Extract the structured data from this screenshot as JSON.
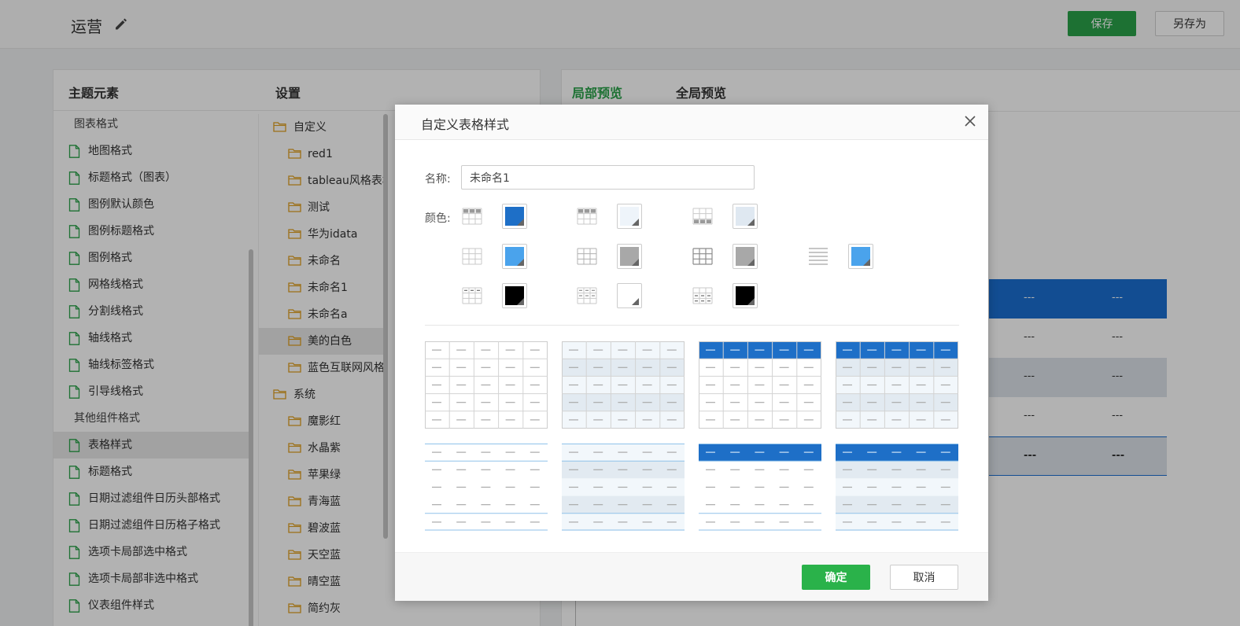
{
  "header": {
    "title": "运营",
    "save_label": "保存",
    "save_as_label": "另存为"
  },
  "left_panel": {
    "theme_title": "主题元素",
    "settings_title": "设置",
    "theme_items": [
      {
        "label": "图表格式",
        "group": true
      },
      {
        "label": "地图格式"
      },
      {
        "label": "标题格式（图表）"
      },
      {
        "label": "图例默认颜色"
      },
      {
        "label": "图例标题格式"
      },
      {
        "label": "图例格式"
      },
      {
        "label": "网格线格式"
      },
      {
        "label": "分割线格式"
      },
      {
        "label": "轴线格式"
      },
      {
        "label": "轴线标签格式"
      },
      {
        "label": "引导线格式"
      },
      {
        "label": "其他组件格式",
        "group": true
      },
      {
        "label": "表格样式",
        "selected": true
      },
      {
        "label": "标题格式"
      },
      {
        "label": "日期过滤组件日历头部格式"
      },
      {
        "label": "日期过滤组件日历格子格式"
      },
      {
        "label": "选项卡局部选中格式"
      },
      {
        "label": "选项卡局部非选中格式"
      },
      {
        "label": "仪表组件样式"
      }
    ],
    "settings_items": [
      {
        "label": "自定义",
        "top": true
      },
      {
        "label": "red1"
      },
      {
        "label": "tableau风格表格"
      },
      {
        "label": "测试"
      },
      {
        "label": "华为idata"
      },
      {
        "label": "未命名"
      },
      {
        "label": "未命名1"
      },
      {
        "label": "未命名a"
      },
      {
        "label": "美的白色",
        "selected": true
      },
      {
        "label": "蓝色互联网风格"
      },
      {
        "label": "系统",
        "top": true
      },
      {
        "label": "魔影红"
      },
      {
        "label": "水晶紫"
      },
      {
        "label": "苹果绿"
      },
      {
        "label": "青海蓝"
      },
      {
        "label": "碧波蓝"
      },
      {
        "label": "天空蓝"
      },
      {
        "label": "晴空蓝"
      },
      {
        "label": "简约灰"
      }
    ]
  },
  "right_panel": {
    "tab_local": "局部预览",
    "tab_global": "全局预览",
    "cells": "---"
  },
  "modal": {
    "title": "自定义表格样式",
    "name_label": "名称:",
    "name_value": "未命名1",
    "color_label": "颜色:",
    "swatches": [
      {
        "icon": "table-header-cell-icon",
        "color": "#1e6fc7"
      },
      {
        "icon": "table-header-row-icon",
        "color": "#eef4fa"
      },
      {
        "icon": "table-footer-row-icon",
        "color": "#dfe8f1"
      },
      {
        "icon": "table-body-grid-icon",
        "color": "#4aa3ec"
      },
      {
        "icon": "table-grid-light-icon",
        "color": "#a8a8a8"
      },
      {
        "icon": "table-grid-bold-icon",
        "color": "#a8a8a8"
      },
      {
        "icon": "table-horizontal-lines-icon",
        "color": "#4aa3ec"
      },
      {
        "icon": "table-text-header-icon",
        "color": "#000000"
      },
      {
        "icon": "table-text-body-icon",
        "color": "#ffffff"
      },
      {
        "icon": "table-text-footer-icon",
        "color": "#000000"
      }
    ],
    "ok_label": "确定",
    "cancel_label": "取消"
  },
  "colors": {
    "accent_green": "#2aa34a",
    "table_blue": "#1e6fc7"
  }
}
